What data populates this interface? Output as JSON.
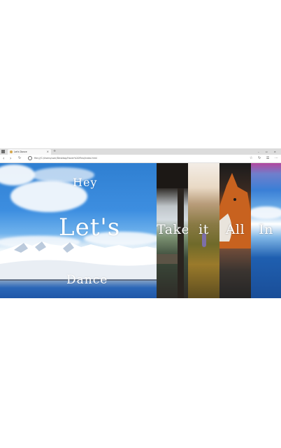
{
  "browser": {
    "tab_title": "Let's Dance",
    "tab_close": "×",
    "new_tab": "+",
    "window_controls": "– ▫ ×",
    "url": "file:///C:/Users/user/Desktop/Hover%20Flex/index.html",
    "nav": {
      "back": "‹",
      "forward": "›",
      "refresh": "↻"
    },
    "toolbar_icons": {
      "star": "☆",
      "refresh2": "↻",
      "hub": "☰",
      "more": "⋯"
    }
  },
  "page": {
    "main_panel": {
      "word_top": "Hey",
      "word_middle": "Let's",
      "word_bottom": "Dance"
    },
    "panels": [
      {
        "word": "Take"
      },
      {
        "word": "it"
      },
      {
        "word": "All"
      },
      {
        "word": "In"
      }
    ]
  },
  "colors": {
    "sky": "#2f7fd1",
    "text": "#ffffff",
    "tabbar": "#dcdcdc"
  }
}
